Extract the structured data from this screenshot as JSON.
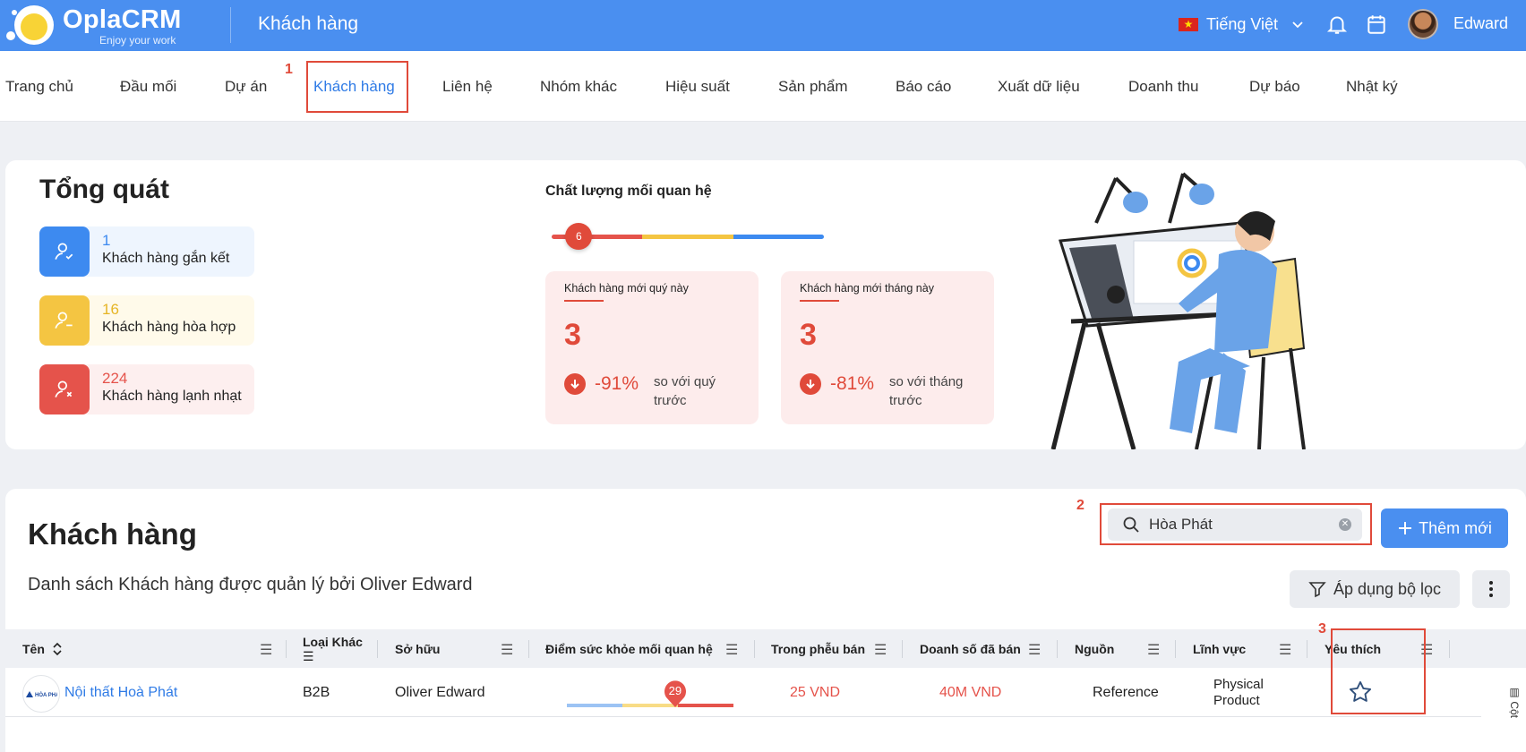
{
  "header": {
    "brand": "OplaCRM",
    "tagline": "Enjoy your work",
    "page_title": "Khách hàng",
    "language": "Tiếng Việt",
    "user": "Edward"
  },
  "nav": {
    "items": [
      {
        "label": "Trang chủ"
      },
      {
        "label": "Đầu mối"
      },
      {
        "label": "Dự án"
      },
      {
        "label": "Khách hàng"
      },
      {
        "label": "Liên hệ"
      },
      {
        "label": "Nhóm khác"
      },
      {
        "label": "Hiệu suất"
      },
      {
        "label": "Sản phẩm"
      },
      {
        "label": "Báo cáo"
      },
      {
        "label": "Xuất dữ liệu"
      },
      {
        "label": "Doanh thu"
      },
      {
        "label": "Dự báo"
      },
      {
        "label": "Nhật ký"
      }
    ],
    "active_index": 3
  },
  "annotations": {
    "step1": "1",
    "step2": "2",
    "step3": "3"
  },
  "overview": {
    "title": "Tổng quát",
    "stats": [
      {
        "value": "1",
        "label": "Khách hàng gắn kết",
        "color": "#3d8af0",
        "bg": "#eef5fe",
        "icon": "user-check-icon"
      },
      {
        "value": "16",
        "label": "Khách hàng hòa hợp",
        "color": "#f4c542",
        "bg": "#fffaea",
        "icon": "user-minus-icon"
      },
      {
        "value": "224",
        "label": "Khách hàng lạnh nhạt",
        "color": "#e5534b",
        "bg": "#fdefef",
        "icon": "user-x-icon"
      }
    ],
    "relationship_quality": {
      "title": "Chất lượng mối quan hệ",
      "score": "6",
      "score_fraction": 0.1
    },
    "cards": [
      {
        "label": "Khách hàng mới quý này",
        "value": "3",
        "change": "-91%",
        "compare": "so với quý trước"
      },
      {
        "label": "Khách hàng mới tháng này",
        "value": "3",
        "change": "-81%",
        "compare": "so với tháng trước"
      }
    ]
  },
  "customers": {
    "title": "Khách hàng",
    "subtitle": "Danh sách Khách hàng được quản lý bởi Oliver Edward",
    "search": {
      "value": "Hòa Phát",
      "placeholder": ""
    },
    "add_button": "Thêm mới",
    "filter_button": "Áp dụng bộ lọc",
    "columns": {
      "name": "Tên",
      "type": "Loại Khác",
      "owner": "Sở hữu",
      "health": "Điểm sức khỏe mối quan hệ",
      "pipeline": "Trong phễu bán",
      "sold": "Doanh số đã bán",
      "source": "Nguồn",
      "industry": "Lĩnh vực",
      "favorite": "Yêu thích"
    },
    "rows": [
      {
        "name": "Nội thất Hoà Phát",
        "logo_text": "HÒA PHÁT",
        "type": "B2B",
        "owner": "Oliver Edward",
        "health_score": "29",
        "health_fraction": 0.65,
        "pipeline": "25 VND",
        "sold": "40M VND",
        "source": "Reference",
        "industry": "Physical Product",
        "favorite": false
      }
    ],
    "side_label": "Cột"
  }
}
